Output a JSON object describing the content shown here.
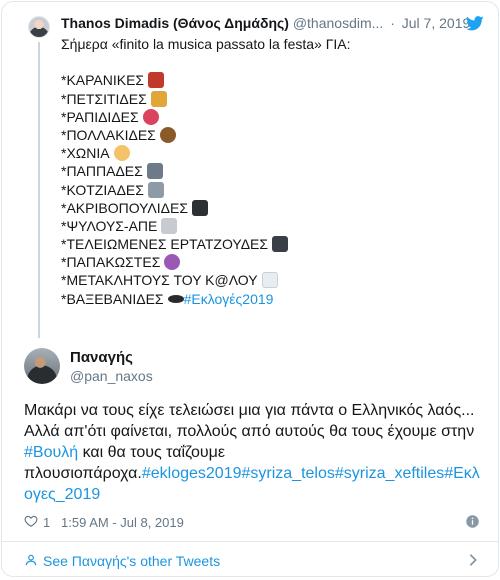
{
  "parent": {
    "name": "Thanos Dimadis (Θάνος Δημάδης)",
    "handle": "@thanosdim...",
    "date": "Jul 7, 2019",
    "intro": "Σήμερα «finito la musica passato la festa» ΓΙΑ:",
    "items": [
      {
        "text": "*ΚΑΡΑΝΙΚΕΣ",
        "emoji": "ogre-emoji",
        "color": "#c0392b"
      },
      {
        "text": "*ΠΕΤΣΙΤΙΔΕΣ",
        "emoji": "money-bag-emoji",
        "color": "#e0a63a"
      },
      {
        "text": "*ΡΑΠΙΔΙΔΕΣ",
        "emoji": "lying-face-emoji",
        "color": "#d9435e"
      },
      {
        "text": "*ΠΟΛΛΑΚΙΔΕΣ",
        "emoji": "pile-of-poo-emoji",
        "color": "#8a5a2b"
      },
      {
        "text": "*ΧΩΝΙΑ",
        "emoji": "clown-face-emoji",
        "color": "#f3c26b"
      },
      {
        "text": "*ΠΑΠΠΑΔΕΣ",
        "emoji": "rocket-emoji",
        "color": "#6c7a89"
      },
      {
        "text": "*ΚΟΤΖΙΑΔΕΣ",
        "emoji": "tombstone-emoji",
        "color": "#8e9aa6"
      },
      {
        "text": "*ΑΚΡΙΒΟΠΟΥΛΙΔΕΣ",
        "emoji": "spider-emoji",
        "color": "#2c2f33"
      },
      {
        "text": "*ΨΥΛΟΥΣ-ΑΠΕ",
        "emoji": "mouse-emoji",
        "color": "#c7cbd0"
      },
      {
        "text": "*ΤΕΛΕΙΩΜΕΝΕΣ ΕΡΤΑΤΖΟΥΔΕΣ",
        "emoji": "movie-camera-emoji",
        "color": "#3a3f45"
      },
      {
        "text": "*ΠΑΠΑΚΩΣΤΕΣ",
        "emoji": "crystal-ball-emoji",
        "color": "#9b59b6"
      },
      {
        "text": "*ΜΕΤΑΚΛΗΤΟΥΣ ΤΟΥ Κ@ΛΟΥ",
        "emoji": "toilet-paper-emoji",
        "color": "#e8edf2"
      },
      {
        "text": "*ΒΑΞΕΒΑΝΙΔΕΣ",
        "emoji": "hole-emoji",
        "color": "#2a2a2a"
      }
    ],
    "last_hashtag": "#Εκλογές2019"
  },
  "reply": {
    "name": "Παναγής",
    "handle": "@pan_naxos",
    "line1": "Μακάρι να τους είχε τελειώσει μια για πάντα ο Ελληνικός λαός...",
    "line2": "Αλλά απ'ότι φαίνεται, πολλούς από αυτούς θα τους έχουμε στην",
    "line3_hashtag": "#Βουλή",
    "line3_rest": " και θα τους ταΐζουμε",
    "line4_text": "πλουσιοπάροχα.",
    "line4_hashtags": "#ekloges2019#syriza_telos#syriza_xeftiles#Εκλ",
    "line5_hashtag": "ογες_2019",
    "likes": "1",
    "timestamp": "1:59 AM - Jul 8, 2019"
  },
  "footer": {
    "see_more": "See Παναγής's other Tweets"
  },
  "colors": {
    "accent": "#1b95e0",
    "muted": "#657786",
    "border": "#e1e8ed"
  }
}
